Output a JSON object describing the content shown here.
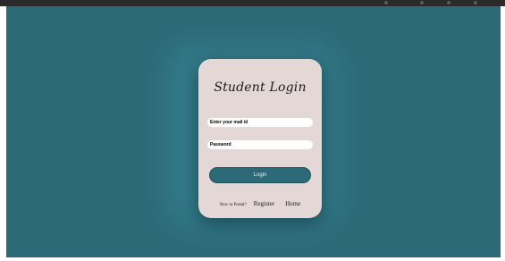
{
  "login": {
    "title": "Student Login",
    "email_placeholder": "Enter your mail id",
    "password_placeholder": "Password",
    "login_label": "Login",
    "new_prompt": "New to Portal?",
    "register_label": "Register",
    "home_label": "Home"
  },
  "colors": {
    "background": "#2d6a78",
    "card": "#e4d8d6",
    "button": "#2d6a78"
  }
}
